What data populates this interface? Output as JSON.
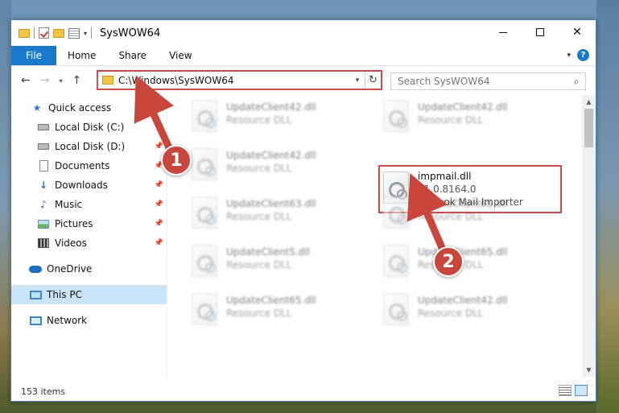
{
  "window": {
    "title": "SysWOW64"
  },
  "ribbon": {
    "tabs": [
      "File",
      "Home",
      "Share",
      "View"
    ],
    "help_label": "?"
  },
  "address": {
    "path": "C:\\Windows\\SysWOW64"
  },
  "search": {
    "placeholder": "Search SysWOW64"
  },
  "sidebar": {
    "items": [
      {
        "label": "Quick access",
        "icon": "star-icon"
      },
      {
        "label": "Local Disk (C:)",
        "icon": "drive-icon",
        "pinned": true
      },
      {
        "label": "Local Disk (D:)",
        "icon": "drive-icon",
        "pinned": true
      },
      {
        "label": "Documents",
        "icon": "documents-icon",
        "pinned": true
      },
      {
        "label": "Downloads",
        "icon": "downloads-icon",
        "pinned": true
      },
      {
        "label": "Music",
        "icon": "music-icon",
        "pinned": true
      },
      {
        "label": "Pictures",
        "icon": "pictures-icon",
        "pinned": true
      },
      {
        "label": "Videos",
        "icon": "videos-icon",
        "pinned": true
      },
      {
        "label": "OneDrive",
        "icon": "onedrive-icon"
      },
      {
        "label": "This PC",
        "icon": "this-pc-icon",
        "selected": true
      },
      {
        "label": "Network",
        "icon": "network-icon"
      }
    ]
  },
  "files": [
    {
      "name": "UpdateClient42.dll",
      "type": "Resource DLL"
    },
    {
      "name": "UpdateClient42.dll",
      "type": "Resource DLL"
    },
    {
      "name": "UpdateClient42.dll",
      "type": "Resource DLL"
    },
    {
      "name": "impmail.dll",
      "version": "11.0.8164.0",
      "description": "Outlook Mail Importer"
    },
    {
      "name": "UpdateClient63.dll",
      "type": "Resource DLL"
    },
    {
      "name": "UpdateClient65.dll",
      "type": "Resource DLL"
    },
    {
      "name": "UpdateClient5.dll",
      "type": "Resource DLL"
    },
    {
      "name": "UpdateClient65.dll",
      "type": "Resource DLL"
    },
    {
      "name": "UpdateClient65.dll",
      "type": "Resource DLL"
    },
    {
      "name": "UpdateClient42.dll",
      "type": "Resource DLL"
    }
  ],
  "status": {
    "item_count": "153 items"
  },
  "annotations": {
    "step1": "1",
    "step2": "2",
    "color": "#c9463d"
  }
}
